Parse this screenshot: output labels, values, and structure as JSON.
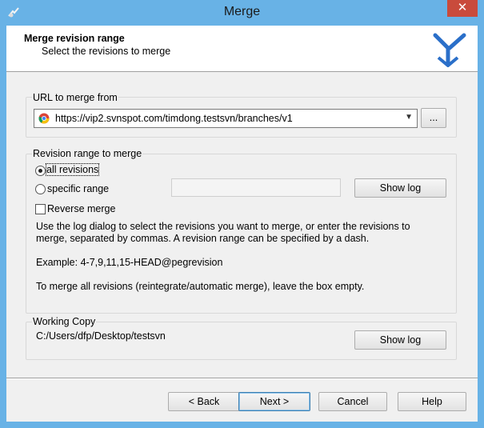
{
  "window": {
    "title": "Merge",
    "close_symbol": "✕"
  },
  "header": {
    "title": "Merge revision range",
    "subtitle": "Select the revisions to merge"
  },
  "url_group": {
    "title": "URL to merge from",
    "url_value": "https://vip2.svnspot.com/timdong.testsvn/branches/v1",
    "browse_label": "..."
  },
  "revision_group": {
    "title": "Revision range to merge",
    "all_revisions_label": "all revisions",
    "all_revisions_checked": true,
    "specific_range_label": "specific range",
    "specific_range_value": "",
    "show_log_label": "Show log",
    "reverse_merge_label": "Reverse merge",
    "reverse_merge_checked": false,
    "help_line1": "Use the log dialog to select the revisions you want to merge, or enter the revisions to",
    "help_line2": "merge, separated by commas. A revision range can be specified by a dash.",
    "example": "Example: 4-7,9,11,15-HEAD@pegrevision",
    "note": "To merge all revisions (reintegrate/automatic merge), leave the box empty."
  },
  "working_copy_group": {
    "title": "Working Copy",
    "path": "C:/Users/dfp/Desktop/testsvn",
    "show_log_label": "Show log"
  },
  "buttons": {
    "back": "< Back",
    "next": "Next >",
    "cancel": "Cancel",
    "help": "Help"
  },
  "icons": {
    "app": "tortoisesvn-icon",
    "browser": "chrome-icon",
    "logo": "merge-logo"
  },
  "colors": {
    "titlebar": "#68b2e6",
    "close": "#c94b3c",
    "logo": "#2a6fc9"
  }
}
